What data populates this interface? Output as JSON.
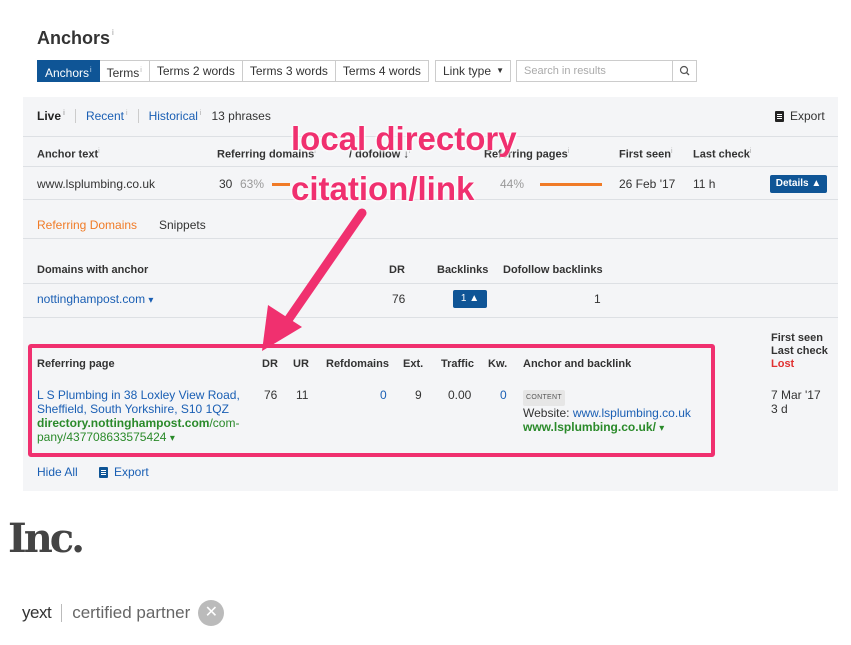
{
  "page_title": "Anchors",
  "info_mark": "i",
  "tabs": [
    {
      "label": "Anchors",
      "active": true,
      "has_info": true
    },
    {
      "label": "Terms",
      "active": false,
      "has_info": true
    },
    {
      "label": "Terms 2 words",
      "active": false,
      "has_info": false
    },
    {
      "label": "Terms 3 words",
      "active": false,
      "has_info": false
    },
    {
      "label": "Terms 4 words",
      "active": false,
      "has_info": false
    }
  ],
  "link_type": {
    "label": "Link type",
    "caret": "▼"
  },
  "search": {
    "placeholder": "Search in results",
    "icon": "search-icon"
  },
  "mode_bar": {
    "live": "Live",
    "recent": "Recent",
    "historical": "Historical",
    "phrases": "13 phrases",
    "export": "Export"
  },
  "anchors_table": {
    "headers": {
      "anchor_text": "Anchor text",
      "referring_domains": "Referring domains",
      "dofollow": "/ dofollow",
      "referring_pages": "Referring pages",
      "first_seen": "First seen",
      "last_check": "Last check"
    },
    "row": {
      "anchor": "www.lsplumbing.co.uk",
      "ref_domains": "30",
      "ref_domains_pct": "63%",
      "dofollow_pct": "44%",
      "first_seen": "26 Feb '17",
      "last_check": "11 h",
      "details": "Details ▲"
    }
  },
  "sub_tabs": {
    "referring_domains": "Referring Domains",
    "snippets": "Snippets"
  },
  "domains_table": {
    "headers": {
      "domain": "Domains with anchor",
      "dr": "DR",
      "backlinks": "Backlinks",
      "dofollow": "Dofollow backlinks"
    },
    "row": {
      "domain": "nottinghampost.com",
      "caret": "▾",
      "dr": "76",
      "backlinks": "1 ▲",
      "dofollow": "1"
    }
  },
  "pages_table": {
    "headers": {
      "page": "Referring page",
      "dr": "DR",
      "ur": "UR",
      "refdomains": "Refdomains",
      "ext": "Ext.",
      "traffic": "Traffic",
      "kw": "Kw.",
      "anchor": "Anchor and backlink"
    },
    "right_headers": {
      "first_seen": "First seen",
      "last_check": "Last check",
      "lost": "Lost"
    },
    "row": {
      "title_line1": "L S Plumbing in 38 Loxley View Road,",
      "title_line2": "Sheffield, South Yorkshire, S10 1QZ",
      "url_domain": "directory.nottinghampost.com",
      "url_path1": "/com-",
      "url_path2": "pany/437708633575424",
      "url_caret": "▾",
      "dr": "76",
      "ur": "11",
      "refdomains": "0",
      "ext": "9",
      "traffic": "0.00",
      "kw": "0",
      "tag": "CONTENT",
      "website_label": "Website:",
      "website_link": "www.lsplumbing.co.uk",
      "backlink": "www.lsplumbing.co.uk/",
      "backlink_caret": "▾",
      "first_seen": "7 Mar '17",
      "last_check": "3 d"
    }
  },
  "footer": {
    "hide_all": "Hide All",
    "export": "Export"
  },
  "annotation": {
    "line1": "local directory",
    "line2": "citation/link",
    "color": "#f0306f"
  },
  "logos": {
    "inc": "Inc.",
    "yext": "yext",
    "certified": "certified partner",
    "badge": "✕"
  },
  "colors": {
    "accent": "#0f5596",
    "orange": "#f07b27",
    "link": "#1a5fb4",
    "green": "#2a8a2a",
    "highlight": "#f0306f"
  }
}
